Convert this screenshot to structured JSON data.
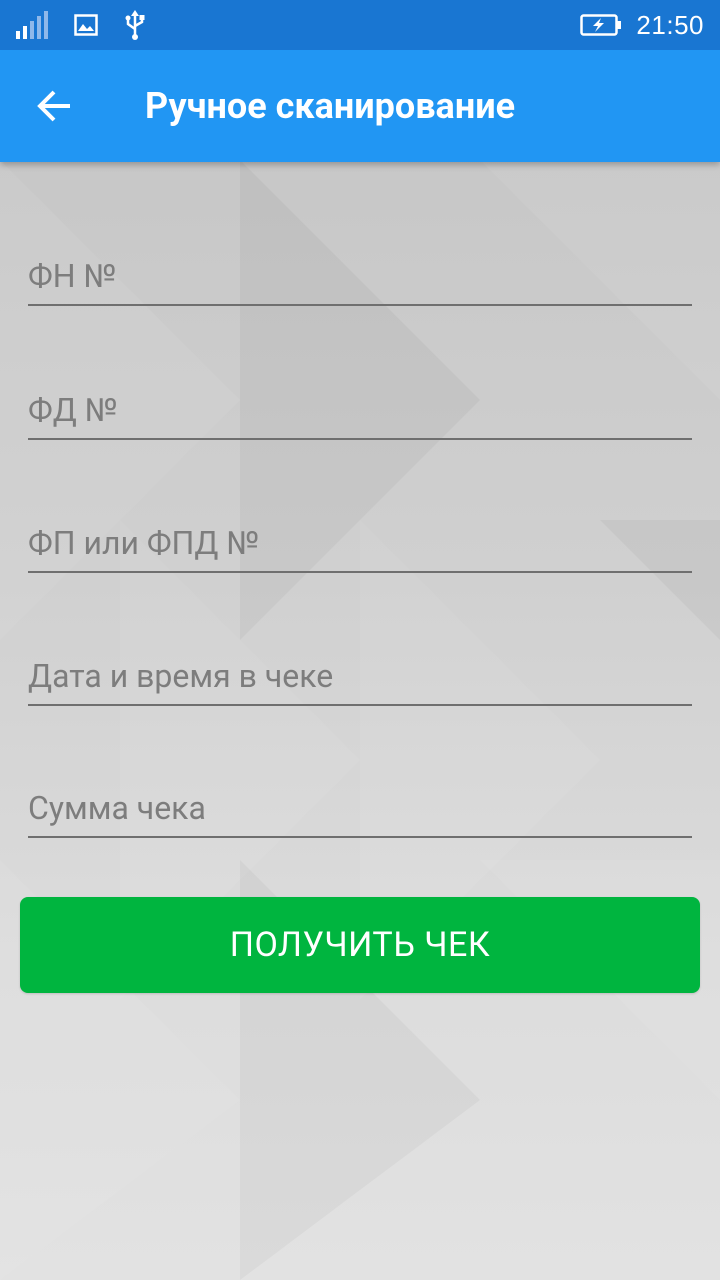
{
  "status_bar": {
    "time": "21:50",
    "icons": [
      "signal-icon",
      "image-icon",
      "usb-icon",
      "battery-charging-icon"
    ]
  },
  "app_bar": {
    "back_icon": "arrow-back-icon",
    "title": "Ручное сканирование"
  },
  "form": {
    "fields": [
      {
        "placeholder": "ФН №",
        "value": ""
      },
      {
        "placeholder": "ФД №",
        "value": ""
      },
      {
        "placeholder": "ФП или ФПД №",
        "value": ""
      },
      {
        "placeholder": "Дата и время в чеке",
        "value": ""
      },
      {
        "placeholder": "Сумма чека",
        "value": ""
      }
    ],
    "submit_label": "ПОЛУЧИТЬ ЧЕК"
  },
  "colors": {
    "status_bar": "#1976d2",
    "app_bar": "#2196f3",
    "button": "#00b53f",
    "underline": "#6f6f6f",
    "placeholder": "#7d7d7d"
  }
}
